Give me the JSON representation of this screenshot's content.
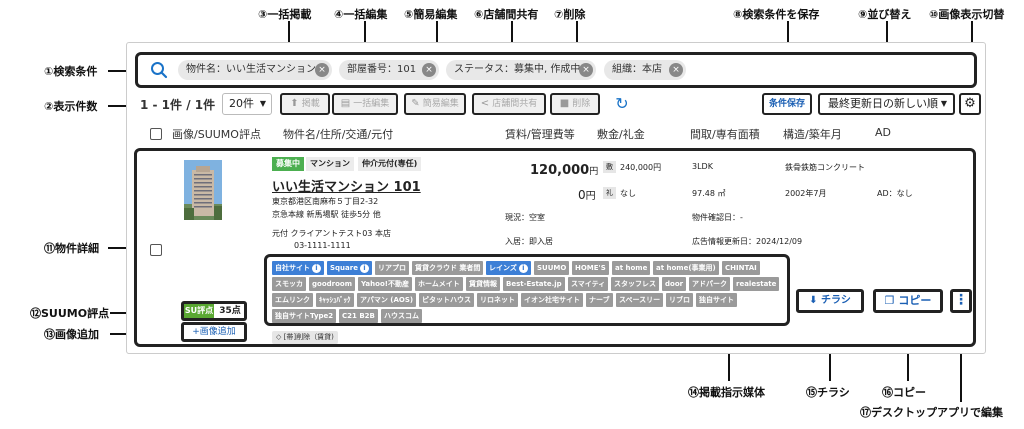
{
  "annotations": {
    "a1": "①検索条件",
    "a2": "②表示件数",
    "a3": "③一括掲載",
    "a4": "④一括編集",
    "a5": "⑤簡易編集",
    "a6": "⑥店舗間共有",
    "a7": "⑦削除",
    "a8": "⑧検索条件を保存",
    "a9": "⑨並び替え",
    "a10": "⑩画像表示切替",
    "a11": "⑪物件詳細",
    "a12": "⑫SUUMO評点",
    "a13": "⑬画像追加",
    "a14": "⑭掲載指示媒体",
    "a15": "⑮チラシ",
    "a16": "⑯コピー",
    "a17": "⑰デスクトップアプリで編集"
  },
  "search": {
    "chips": [
      "物件名：いい生活マンション",
      "部屋番号：101",
      "ステータス：募集中, 作成中",
      "組織：本店"
    ],
    "chip_close": "×"
  },
  "toolbar": {
    "count_text": "1 - 1件 / 1件",
    "page_size": "20件",
    "caret": "▼",
    "bulk_publish": "掲載",
    "bulk_edit": "一括編集",
    "quick_edit": "簡易編集",
    "share": "店舗間共有",
    "delete": "削除",
    "refresh": "↻",
    "save_search": "条件保存",
    "sort": "最終更新日の新しい順",
    "view_toggle": "⚙"
  },
  "columns": {
    "image": "画像/SUUMO評点",
    "property": "物件名/住所/交通/元付",
    "rent": "賃料/管理費等",
    "deposit": "敷金/礼金",
    "layout": "間取/専有面積",
    "structure": "構造/築年月",
    "ad": "AD"
  },
  "property": {
    "badges": [
      "募集中",
      "マンション",
      "仲介元付(専任)"
    ],
    "name": "いい生活マンション 101",
    "address": "東京都港区南麻布５丁目2-32",
    "access": "京急本線 新馬場駅 徒歩5分 他",
    "motozuke": "元付 クライアントテスト03 本店",
    "phone": "03-1111-1111",
    "rent": "120,000",
    "rent_unit": "円",
    "fee": "0",
    "fee_unit": "円",
    "deposit_tag": "敷",
    "deposit": "240,000円",
    "key_tag": "礼",
    "key_money": "なし",
    "layout": "3LDK",
    "area": "97.48 ㎡",
    "structure": "鉄骨鉄筋コンクリート",
    "built": "2002年7月",
    "ad": "AD：なし",
    "current": "現況：空室",
    "movein": "入居：即入居",
    "confirmed": "物件確認日：-",
    "updated": "広告情報更新日：2024/12/09",
    "su_label": "SU評点",
    "su_score": "35点",
    "add_image": "+画像追加"
  },
  "media": {
    "row1": [
      "自社サイト",
      "Square",
      "リアプロ",
      "賃貸クラウド 業者間",
      "レインズ",
      "SUUMO",
      "HOME'S",
      "at home",
      "at home(事業用)",
      "CHINTAI"
    ],
    "row2": [
      "スモッカ",
      "goodroom",
      "Yahoo!不動産",
      "ホームメイト",
      "賃貸情報",
      "Best-Estate.jp",
      "スマイティ",
      "スタッフレス",
      "door",
      "アドパーク",
      "realestate"
    ],
    "row3": [
      "エムリンク",
      "ｷｬｯｼｭﾊﾞｯｸ",
      "アパマン (AOS)",
      "ピタットハウス",
      "リロネット",
      "イオン社宅サイト",
      "ナーブ",
      "スペースリー",
      "リブロ",
      "独自サイト"
    ],
    "row4": [
      "独自サイトType2",
      "C21 B2B",
      "ハウスコム"
    ],
    "info_mark": "i",
    "pr_tag": "[帯]削除（賃貸)"
  },
  "actions": {
    "flyer": "チラシ",
    "copy": "コピー",
    "more": "⋮"
  }
}
